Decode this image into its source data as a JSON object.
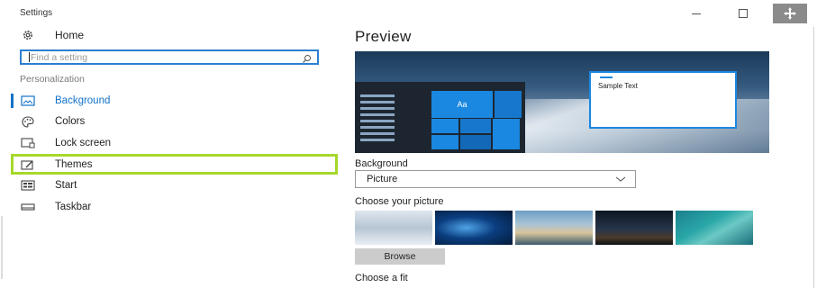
{
  "window": {
    "title": "Settings"
  },
  "nav": {
    "home_label": "Home",
    "search_placeholder": "Find a setting",
    "section_heading": "Personalization",
    "items": [
      {
        "label": "Background",
        "icon": "picture-icon",
        "active": true
      },
      {
        "label": "Colors",
        "icon": "palette-icon",
        "active": false
      },
      {
        "label": "Lock screen",
        "icon": "lock-screen-icon",
        "active": false
      },
      {
        "label": "Themes",
        "icon": "brush-icon",
        "active": false
      },
      {
        "label": "Start",
        "icon": "start-grid-icon",
        "active": false
      },
      {
        "label": "Taskbar",
        "icon": "taskbar-icon",
        "active": false
      }
    ]
  },
  "main": {
    "preview_title": "Preview",
    "preview_tile_text": "Aa",
    "preview_sample_text": "Sample Text",
    "background_label": "Background",
    "background_value": "Picture",
    "choose_picture_label": "Choose your picture",
    "browse_label": "Browse",
    "choose_fit_label": "Choose a fit"
  },
  "colors": {
    "accent": "#1272c8",
    "highlight_border": "#a6d82c",
    "search_border": "#2b7fd1"
  }
}
